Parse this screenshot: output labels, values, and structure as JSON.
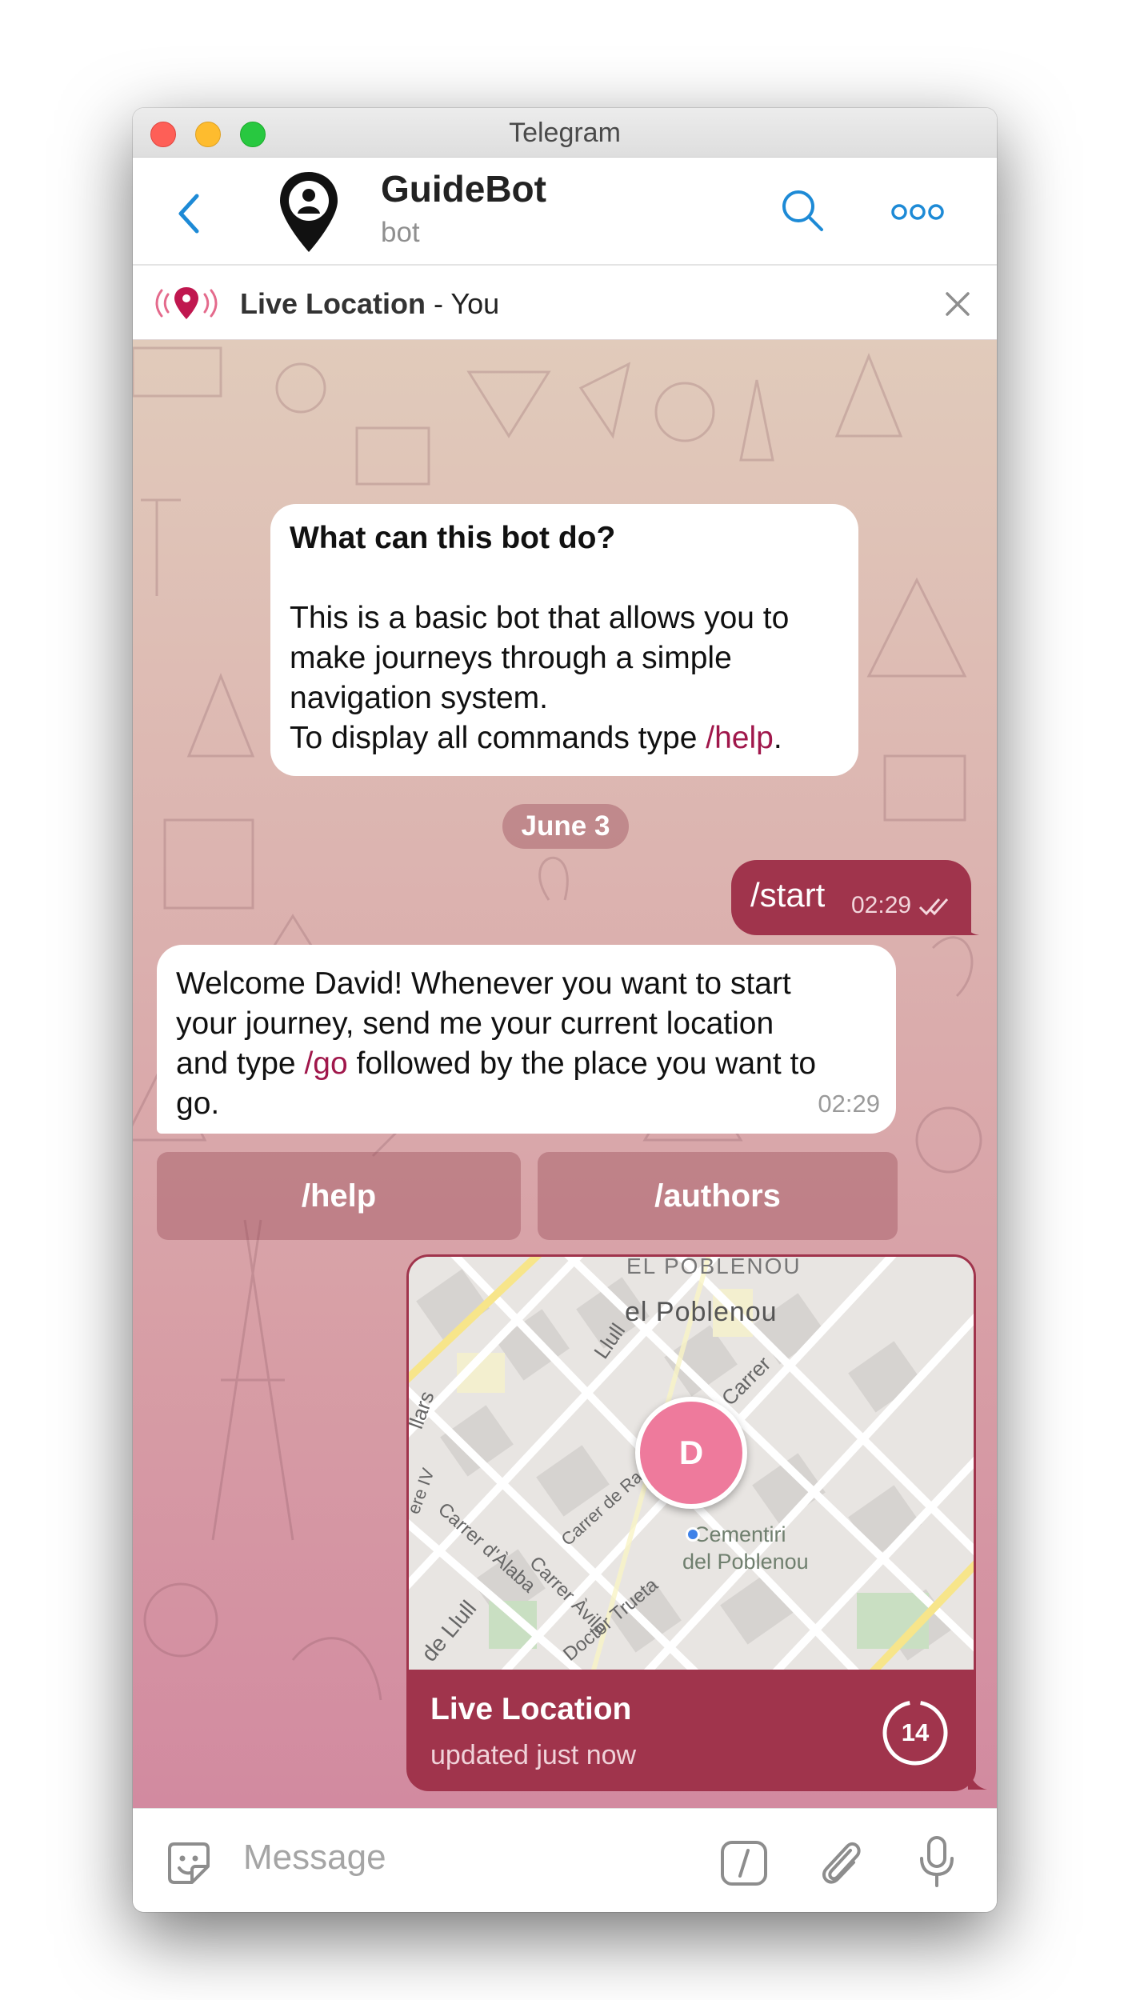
{
  "window": {
    "title": "Telegram"
  },
  "header": {
    "bot_name": "GuideBot",
    "bot_subtitle": "bot"
  },
  "live_bar": {
    "label": "Live Location",
    "suffix": " - You"
  },
  "intro": {
    "question": "What can this bot do?",
    "line1": "This is a basic bot that allows you to",
    "line2": "make journeys through a simple",
    "line3": "navigation system.",
    "line4_prefix": "To display all commands type ",
    "line4_cmd": "/help",
    "line4_suffix": "."
  },
  "date_separator": "June 3",
  "outgoing": {
    "text": "/start",
    "time": "02:29"
  },
  "welcome": {
    "line1": "Welcome David! Whenever you want to start",
    "line2": "your journey, send me your current location",
    "line3_prefix": "and type ",
    "line3_cmd": "/go",
    "line3_suffix": " followed by the place you want to",
    "line4": "go.",
    "time": "02:29"
  },
  "keyboard": {
    "btn1": "/help",
    "btn2": "/authors"
  },
  "location": {
    "title": "Live Location",
    "subtitle": "updated just now",
    "timer": "14",
    "avatar_letter": "D",
    "map_labels": {
      "l1": "EL POBLENOU",
      "l2": "el Poblenou",
      "l3": "Cementiri",
      "l4": "del Poblenou",
      "l5": "Carrer d'Àlaba",
      "l6": "Carrer Àvila",
      "l7": "Doctor Trueta",
      "l8": "de Llull",
      "l9": "Carrer",
      "l10": "Llull",
      "l11": "Carrer de Ramon Turró",
      "l12": "llars",
      "l13": "ere IV"
    }
  },
  "input": {
    "placeholder": "Message"
  },
  "colors": {
    "accent": "#a0344c",
    "command": "#a0174b",
    "link_blue": "#1d8ad6"
  }
}
